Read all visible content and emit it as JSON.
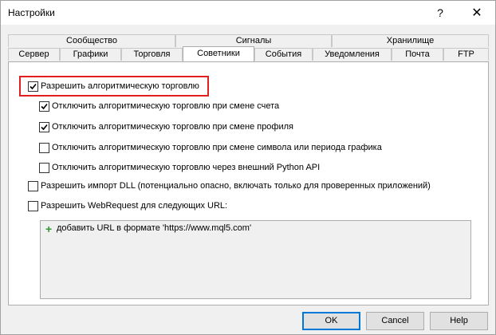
{
  "window": {
    "title": "Настройки",
    "help_glyph": "?",
    "close_glyph": "✕"
  },
  "tabs": {
    "row1": [
      "Сообщество",
      "Сигналы",
      "Хранилище"
    ],
    "row2": [
      "Сервер",
      "Графики",
      "Торговля",
      "Советники",
      "События",
      "Уведомления",
      "Почта",
      "FTP"
    ],
    "active": "Советники"
  },
  "options": [
    {
      "label": "Разрешить алгоритмическую торговлю",
      "checked": true
    },
    {
      "label": "Отключить алгоритмическую торговлю при смене счета",
      "checked": true
    },
    {
      "label": "Отключить алгоритмическую торговлю при смене профиля",
      "checked": true
    },
    {
      "label": "Отключить алгоритмическую торговлю при смене символа или периода графика",
      "checked": false
    },
    {
      "label": "Отключить алгоритмическую торговлю через внешний Python API",
      "checked": false
    },
    {
      "label": "Разрешить импорт DLL (потенциально опасно, включать только для проверенных приложений)",
      "checked": false
    },
    {
      "label": "Разрешить WebRequest для следующих URL:",
      "checked": false
    }
  ],
  "url_list": {
    "add_hint": "добавить URL в формате 'https://www.mql5.com'",
    "add_glyph": "+",
    "accent_color": "#2f9a2f"
  },
  "highlight_color": "#e02020",
  "buttons": {
    "ok": "OK",
    "cancel": "Cancel",
    "help": "Help"
  }
}
